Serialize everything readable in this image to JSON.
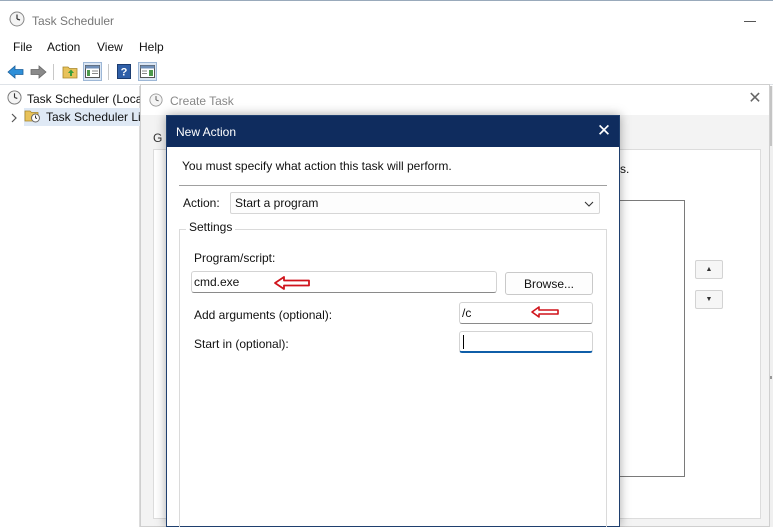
{
  "main_window": {
    "title": "Task Scheduler",
    "menu": [
      "File",
      "Action",
      "View",
      "Help"
    ],
    "toolbar_icons": [
      "back-arrow-icon",
      "forward-arrow-icon",
      "open-folder-icon",
      "show-hide-console-tree-icon",
      "help-icon",
      "show-action-pane-icon"
    ],
    "tree": {
      "root": "Task Scheduler (Local",
      "child": "Task Scheduler Lil"
    }
  },
  "create_task": {
    "title": "Create Task",
    "tab_stub": "G",
    "panel_text_fragment": "arts."
  },
  "new_action": {
    "title": "New Action",
    "instruction": "You must specify what action this task will perform.",
    "action_label": "Action:",
    "action_value": "Start a program",
    "settings_legend": "Settings",
    "program_label": "Program/script:",
    "program_value": "cmd.exe",
    "browse_label": "Browse...",
    "arguments_label": "Add arguments (optional):",
    "arguments_value": "/c",
    "startin_label": "Start in (optional):",
    "startin_value": ""
  },
  "colors": {
    "dialog_titlebar": "#0f2c5e",
    "annotation_arrow": "#d0141c",
    "focus_underline": "#0f5ea8"
  }
}
